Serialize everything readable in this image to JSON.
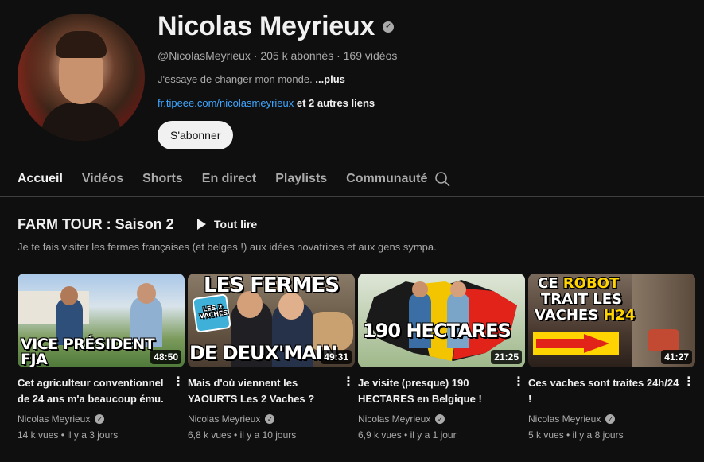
{
  "channel": {
    "name": "Nicolas Meyrieux",
    "verified_mark": "✓",
    "meta": "@NicolasMeyrieux · 205 k abonnés · 169 vidéos",
    "description": "J'essaye de changer mon monde.",
    "more_label": "...plus",
    "link": "fr.tipeee.com/nicolasmeyrieux",
    "other_links": "et 2 autres liens",
    "subscribe_label": "S'abonner"
  },
  "tabs": [
    {
      "label": "Accueil",
      "active": true
    },
    {
      "label": "Vidéos"
    },
    {
      "label": "Shorts"
    },
    {
      "label": "En direct"
    },
    {
      "label": "Playlists"
    },
    {
      "label": "Communauté"
    }
  ],
  "search_icon": "search-icon",
  "section": {
    "title": "FARM TOUR : Saison 2",
    "play_all_label": "Tout lire",
    "description": "Je te fais visiter les fermes françaises (et belges !) aux idées novatrices et aux gens sympa."
  },
  "videos": [
    {
      "thumb_text": "VICE PRÉSIDENT FJA",
      "duration": "48:50",
      "title": "Cet agriculteur conventionnel de 24 ans m'a beaucoup ému.",
      "channel": "Nicolas Meyrieux",
      "meta": "14 k vues • il y a 3 jours"
    },
    {
      "thumb_text_top": "LES FERMES",
      "thumb_text_bottom": "DE DEUX'MAIN",
      "thumb_badge": "LES 2 VACHES",
      "duration": "49:31",
      "title": "Mais d'où viennent les YAOURTS Les 2 Vaches ?",
      "channel": "Nicolas Meyrieux",
      "meta": "6,8 k vues • il y a 10 jours"
    },
    {
      "thumb_text": "190 HECTARES",
      "duration": "21:25",
      "title": "Je visite (presque) 190 HECTARES en Belgique !",
      "channel": "Nicolas Meyrieux",
      "meta": "6,9 k vues • il y a 1 jour"
    },
    {
      "thumb_line1_a": "CE ",
      "thumb_line1_b": "ROBOT",
      "thumb_line2": "TRAIT LES",
      "thumb_line3_a": "VACHES ",
      "thumb_line3_b": "H24",
      "duration": "41:27",
      "title": "Ces vaches sont traites 24h/24 !",
      "channel": "Nicolas Meyrieux",
      "meta": "5 k vues • il y a 8 jours"
    }
  ],
  "colors": {
    "background": "#0f0f0f",
    "link": "#3ea6ff",
    "text_secondary": "#aaaaaa"
  }
}
